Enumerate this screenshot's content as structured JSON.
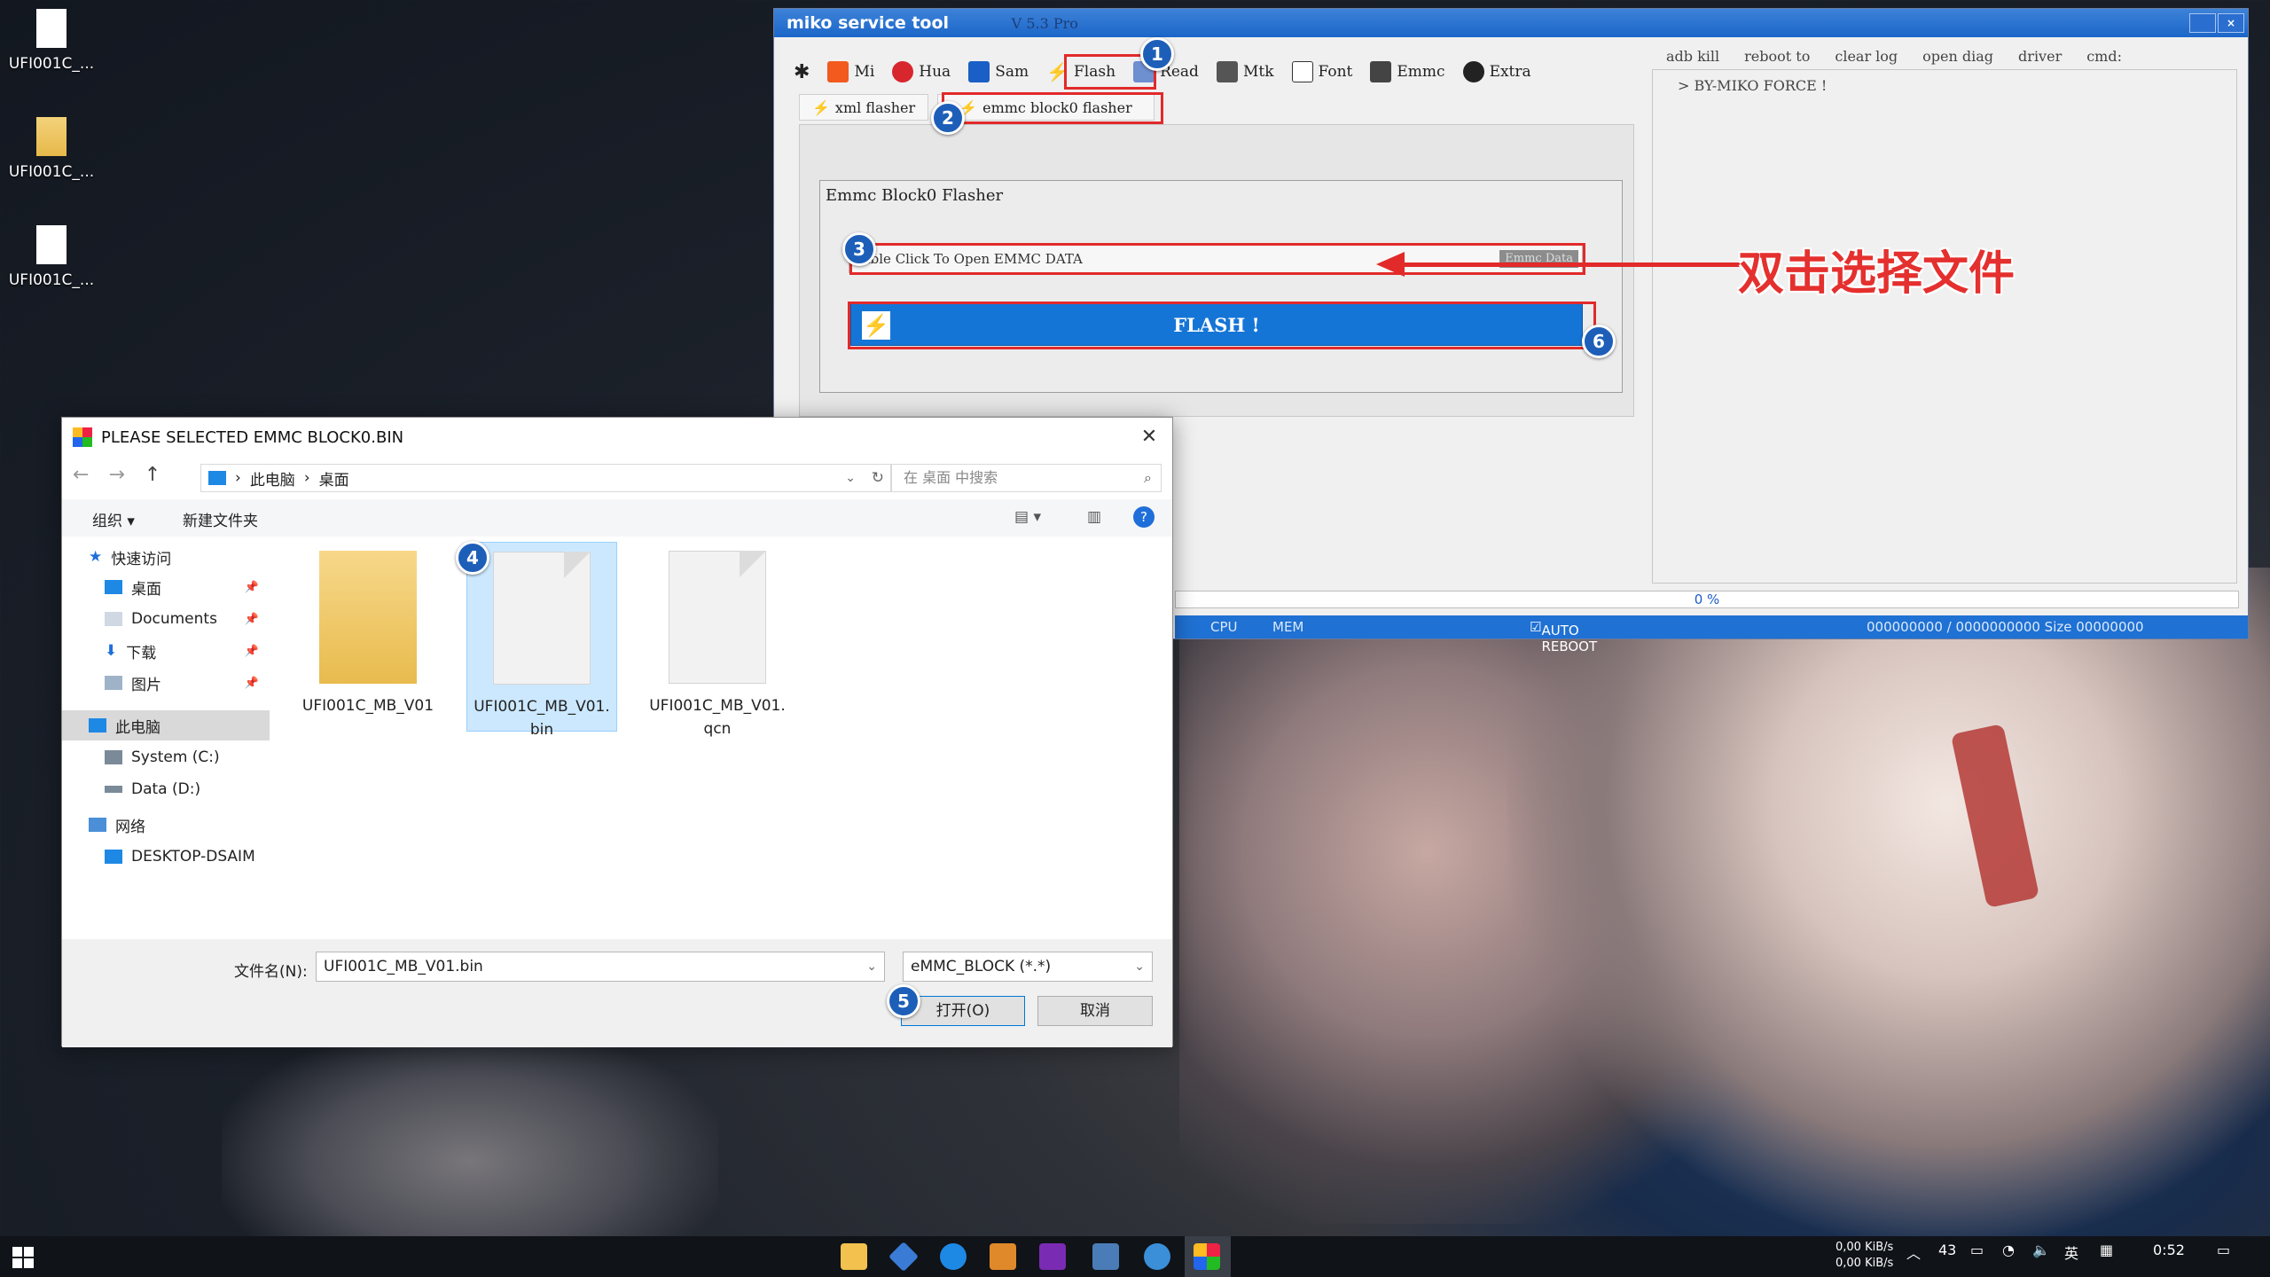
{
  "desktop": {
    "icons": [
      {
        "label": "UFI001C_..."
      },
      {
        "label": "UFI001C_..."
      },
      {
        "label": "UFI001C_..."
      }
    ]
  },
  "miko": {
    "title": "miko service tool",
    "version": "V 5.3 Pro",
    "tabs": [
      {
        "label": "Mi",
        "icon": "mi-icon"
      },
      {
        "label": "Hua",
        "icon": "huawei-icon"
      },
      {
        "label": "Sam",
        "icon": "samsung-icon"
      },
      {
        "label": "Flash",
        "icon": "bolt-icon"
      },
      {
        "label": "Read",
        "icon": "read-icon"
      },
      {
        "label": "Mtk",
        "icon": "chip-icon"
      },
      {
        "label": "Font",
        "icon": "font-icon"
      },
      {
        "label": "Emmc",
        "icon": "emmc-icon"
      },
      {
        "label": "Extra",
        "icon": "extra-icon"
      }
    ],
    "subtabs": [
      {
        "label": "xml flasher"
      },
      {
        "label": "emmc block0 flasher"
      }
    ],
    "group_title": "Emmc Block0 Flasher",
    "emmc_input": "uble Click To Open EMMC DATA",
    "emmc_tag": "Emmc Data",
    "flash_button": "FLASH !",
    "right_actions": [
      "adb kill",
      "reboot to",
      "clear log",
      "open diag",
      "driver",
      "cmd:"
    ],
    "log_text": "> BY-MIKO FORCE !",
    "progress_text": "0  %",
    "status": {
      "cpu": "CPU",
      "mem": "MEM",
      "auto_reboot": "AUTO REBOOT",
      "counter": "000000000  /  0000000000  Size  00000000"
    },
    "colors": {
      "accent": "#1575d6",
      "highlight": "#e22a2a",
      "badge": "#1d5fb8"
    }
  },
  "annotations": {
    "badges": [
      "1",
      "2",
      "3",
      "4",
      "5",
      "6"
    ],
    "note": "双击选择文件"
  },
  "dialog": {
    "title": "PLEASE SELECTED EMMC BLOCK0.BIN",
    "breadcrumb": [
      "此电脑",
      "桌面"
    ],
    "search_placeholder": "在 桌面 中搜索",
    "toolbar": {
      "organize": "组织 ▾",
      "new_folder": "新建文件夹"
    },
    "nav": [
      {
        "label": "快速访问"
      },
      {
        "label": "桌面"
      },
      {
        "label": "Documents"
      },
      {
        "label": "下载"
      },
      {
        "label": "图片"
      },
      {
        "label": "此电脑"
      },
      {
        "label": "System (C:)"
      },
      {
        "label": "Data (D:)"
      },
      {
        "label": "网络"
      },
      {
        "label": "DESKTOP-DSAIM"
      }
    ],
    "files": [
      {
        "name": "UFI001C_MB_V01",
        "type": "folder"
      },
      {
        "name": "UFI001C_MB_V01.\nbin",
        "type": "file"
      },
      {
        "name": "UFI001C_MB_V01.\nqcn",
        "type": "file"
      }
    ],
    "filename_label": "文件名(N):",
    "filename_value": "UFI001C_MB_V01.bin",
    "filetype": "eMMC_BLOCK (*.*)",
    "open_button": "打开(O)",
    "cancel_button": "取消"
  },
  "taskbar": {
    "net_up": "0,00 KiB/s",
    "net_down": "0,00 KiB/s",
    "temp": "43",
    "ime": "英",
    "time": "0:52"
  }
}
